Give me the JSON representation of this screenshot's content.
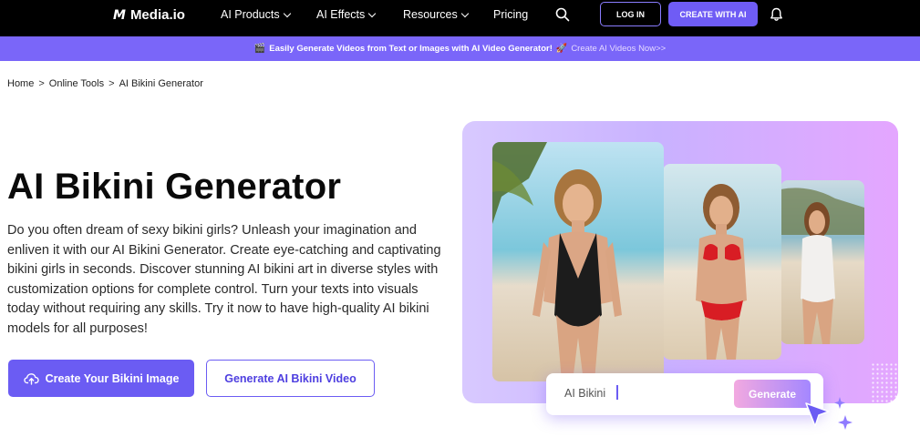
{
  "nav": {
    "logo_mark": "M",
    "logo_text": "Media.io",
    "items": [
      {
        "label": "AI Products",
        "dropdown": true
      },
      {
        "label": "AI Effects",
        "dropdown": true
      },
      {
        "label": "Resources",
        "dropdown": true
      },
      {
        "label": "Pricing",
        "dropdown": false
      }
    ],
    "login_label": "LOG IN",
    "create_label": "CREATE WITH AI",
    "icons": [
      "search-icon",
      "bell-icon"
    ]
  },
  "banner": {
    "emoji_1": "🎬",
    "text": "Easily Generate Videos from Text or Images with AI Video Generator!",
    "emoji_2": "🚀",
    "link": "Create AI Videos Now>>"
  },
  "breadcrumb": {
    "items": [
      "Home",
      "Online Tools",
      "AI Bikini Generator"
    ],
    "separator": ">"
  },
  "hero": {
    "title": "AI Bikini Generator",
    "description": "Do you often dream of sexy bikini girls? Unleash your imagination and enliven it with our AI Bikini Generator. Create eye-catching and captivating bikini girls in seconds. Discover stunning AI bikini art in diverse styles with customization options for complete control. Turn your texts into visuals today without requiring any skills. Try it now to have high-quality AI bikini models for all purposes!",
    "primary_button": "Create Your Bikini Image",
    "secondary_button": "Generate AI Bikini Video"
  },
  "visual": {
    "prompt_text": "AI Bikini",
    "generate_label": "Generate"
  },
  "colors": {
    "accent": "#6b5cf3",
    "banner": "#7a66f9",
    "nav_bg": "#000000"
  }
}
